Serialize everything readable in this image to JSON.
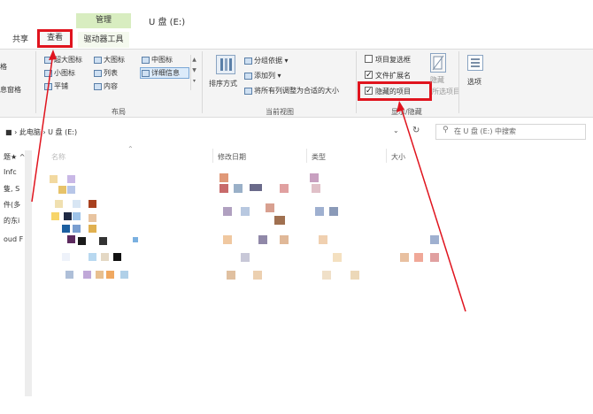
{
  "title_bar": {
    "context_tab_header": "管理",
    "window_title": "U 盘 (E:)"
  },
  "tabs": {
    "share": "共享",
    "view": "查看",
    "drive_tools": "驱动器工具"
  },
  "ribbon": {
    "panes_cut_top": "格",
    "panes_cut_bottom": "息窗格",
    "layout": {
      "extra_large": "超大图标",
      "large": "大图标",
      "medium": "中图标",
      "small": "小图标",
      "list": "列表",
      "details": "详细信息",
      "tiles": "平铺",
      "content": "内容",
      "group_label": "布局"
    },
    "current_view": {
      "sort_by": "排序方式",
      "group_by": "分组依据 ▾",
      "add_columns": "添加列 ▾",
      "size_all_columns": "将所有列调整为合适的大小",
      "group_label": "当前视图"
    },
    "show_hide": {
      "item_checkboxes": "项目复选框",
      "file_extensions": "文件扩展名",
      "hidden_items": "隐藏的项目",
      "hide_selected_a": "隐藏",
      "hide_selected_b": "所选项目",
      "group_label": "显示/隐藏"
    },
    "options": "选项"
  },
  "address_bar": {
    "path_this_pc": "此电脑",
    "path_drive": "U 盘 (E:)",
    "search_placeholder": "在 U 盘 (E:) 中搜索"
  },
  "columns": {
    "name": "名称",
    "date_modified": "修改日期",
    "type": "类型",
    "size": "大小"
  },
  "nav_pane": {
    "items": [
      "题★ ^",
      "Infc",
      "隻, S",
      "件(多",
      "的东i",
      "oud F"
    ]
  },
  "colors": {
    "highlight_red": "#e0141e",
    "context_tab_green": "#d8edc0",
    "selection_blue": "#dcebfa"
  }
}
